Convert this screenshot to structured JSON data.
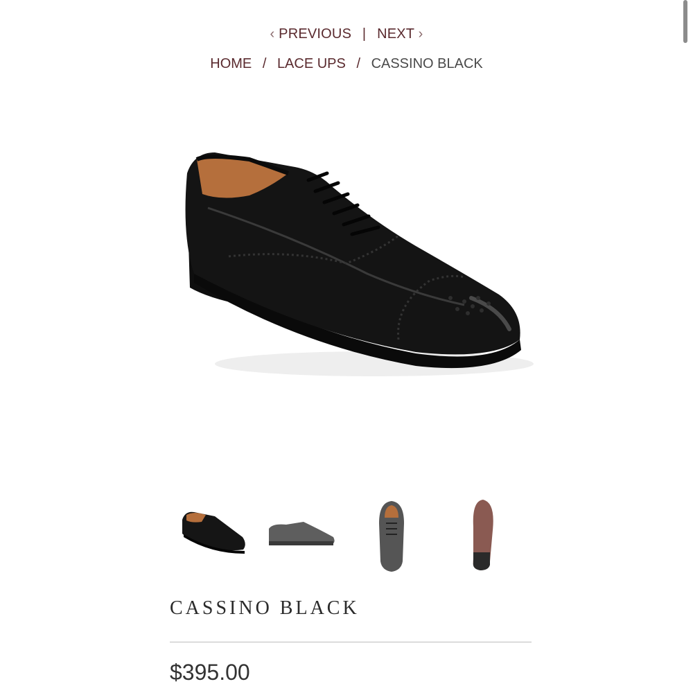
{
  "pager": {
    "previous_label": "PREVIOUS",
    "separator": "|",
    "next_label": "NEXT"
  },
  "breadcrumb": {
    "items": [
      "HOME",
      "LACE UPS",
      "CASSINO BLACK"
    ],
    "separator": "/"
  },
  "product": {
    "name": "CASSINO BLACK",
    "price": "$395.00"
  },
  "gallery": {
    "thumbnails": [
      "angled-view",
      "side-view",
      "top-view",
      "sole-view"
    ]
  },
  "colors": {
    "accent": "#5a2a2e",
    "text": "#2b2b2b",
    "divider": "#bdbdbd",
    "leather": "#121212",
    "lining": "#b56f3c",
    "sole": "#8a5a52"
  }
}
